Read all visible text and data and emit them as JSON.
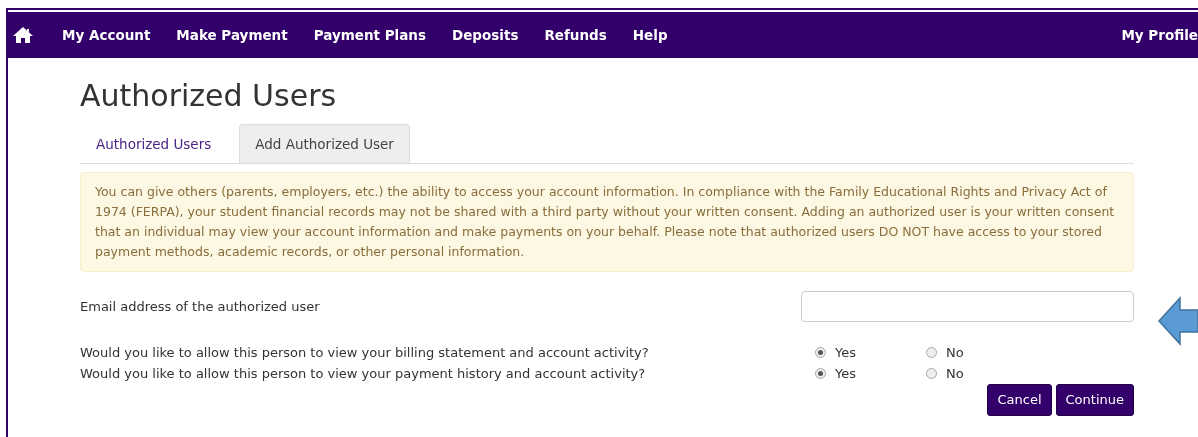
{
  "navbar": {
    "items": [
      "My Account",
      "Make Payment",
      "Payment Plans",
      "Deposits",
      "Refunds",
      "Help"
    ],
    "right_item": "My Profile"
  },
  "page_title": "Authorized Users",
  "tabs": [
    {
      "label": "Authorized Users",
      "selected": false
    },
    {
      "label": "Add Authorized User",
      "selected": true
    }
  ],
  "notice": "You can give others (parents, employers, etc.) the ability to access your account information. In compliance with the Family Educational Rights and Privacy Act of 1974 (FERPA), your student financial records may not be shared with a third party without your written consent. Adding an authorized user is your written consent that an individual may view your account information and make payments on your behalf. Please note that authorized users DO NOT have access to your stored payment methods, academic records, or other personal information.",
  "email_field": {
    "label": "Email address of the authorized user"
  },
  "questions": [
    {
      "text": "Would you like to allow this person to view your billing statement and account activity?",
      "options": [
        {
          "label": "Yes",
          "checked": true
        },
        {
          "label": "No",
          "checked": false
        }
      ]
    },
    {
      "text": "Would you like to allow this person to view your payment history and account activity?",
      "options": [
        {
          "label": "Yes",
          "checked": true
        },
        {
          "label": "No",
          "checked": false
        }
      ]
    }
  ],
  "buttons": [
    "Cancel",
    "Continue"
  ]
}
